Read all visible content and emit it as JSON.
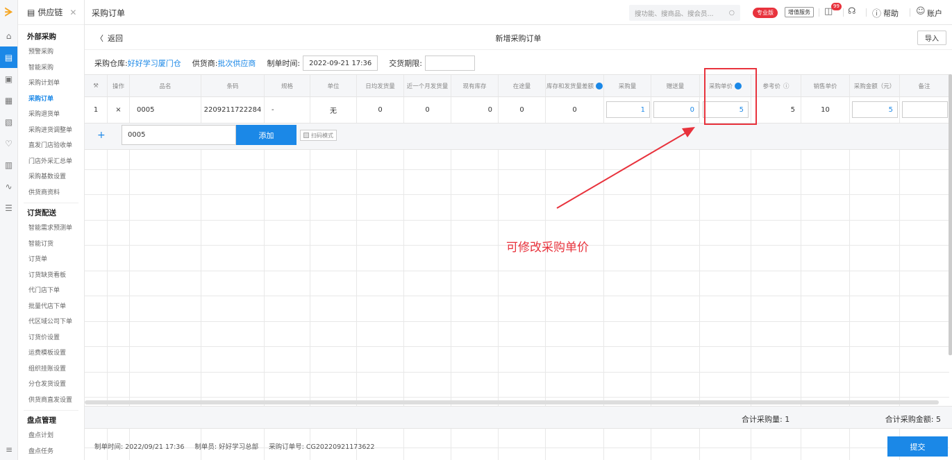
{
  "sidebar": {
    "tab": "供应链",
    "sections": [
      {
        "title": "外部采购",
        "items": [
          "预警采购",
          "智能采购",
          "采购计划单",
          "采购订单",
          "采购退货单",
          "采购进货调整单",
          "直发门店验收单",
          "门店外采汇总单",
          "采购基数设置",
          "供货商资料"
        ]
      },
      {
        "title": "订货配送",
        "items": [
          "智能需求预测单",
          "智能订货",
          "订货单",
          "订货缺货看板",
          "代门店下单",
          "批量代店下单",
          "代区域公司下单",
          "订货价设置",
          "运费模板设置",
          "组织挂账设置",
          "分仓发货设置",
          "供货商直发设置"
        ]
      },
      {
        "title": "盘点管理",
        "items": [
          "盘点计划",
          "盘点任务"
        ]
      }
    ],
    "active_item": "采购订单"
  },
  "header": {
    "title": "采购订单",
    "search_placeholder": "搜功能、搜商品、搜会员...",
    "pro_badge": "专业版",
    "vas_badge": "增值服务",
    "notif_count": "99",
    "help": "帮助",
    "account": "账户"
  },
  "subheader": {
    "back": "返回",
    "page_title": "新增采购订单",
    "import": "导入"
  },
  "filters": {
    "warehouse_label": "采购仓库:",
    "warehouse_value": "好好学习厦门仓",
    "supplier_label": "供货商:",
    "supplier_value": "批次供应商",
    "made_time_label": "制单时间:",
    "made_time_value": "2022-09-21 17:36",
    "delivery_label": "交货期限:",
    "delivery_value": ""
  },
  "table": {
    "columns": [
      "操作",
      "品名",
      "条码",
      "规格",
      "单位",
      "日均发货量",
      "近一个月发货量",
      "现有库存",
      "在途量",
      "库存和发货量差额",
      "采购量",
      "赠送量",
      "采购单价",
      "参考价",
      "销售单价",
      "采购金额（元）",
      "备注"
    ],
    "row": {
      "index": "1",
      "op": "×",
      "name": "0005",
      "barcode": "2209211722284",
      "spec": "-",
      "unit": "无",
      "daily_ship": "0",
      "month_ship": "0",
      "stock": "0",
      "in_transit": "0",
      "diff": "0",
      "purchase_qty": "1",
      "gift_qty": "0",
      "unit_price": "5",
      "ref_price": "5",
      "sale_price": "10",
      "amount": "5",
      "remark": ""
    },
    "add_input": "0005",
    "add_button": "添加",
    "scan_mode": "扫码模式"
  },
  "totals": {
    "qty": "合计采购量: 1",
    "amount": "合计采购金额: 5"
  },
  "footer": {
    "made_time": "制单时间: 2022/09/21 17:36",
    "maker": "制单员: 好好学习总部",
    "order_no": "采购订单号: CG20220921173622",
    "submit": "提交"
  },
  "annotation": {
    "text": "可修改采购单价",
    "color": "#e8323c"
  },
  "colors": {
    "accent": "#1b88e7",
    "red": "#e8323c"
  }
}
